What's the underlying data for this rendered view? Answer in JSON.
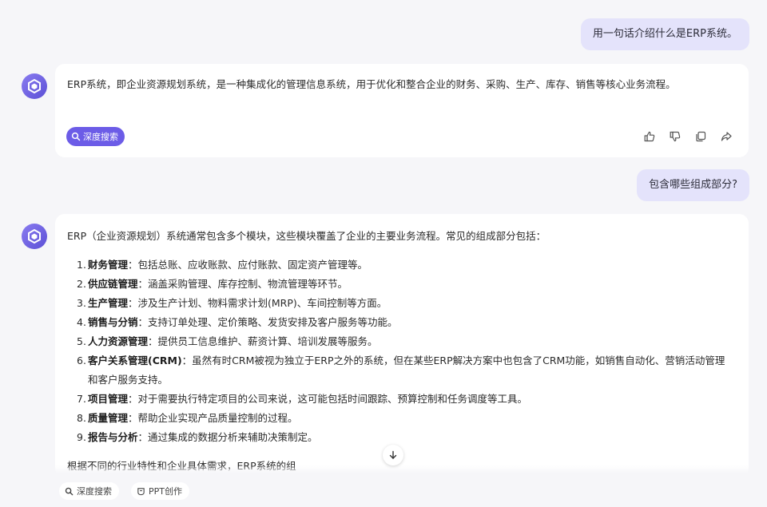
{
  "messages": {
    "q1": "用一句话介绍什么是ERP系统。",
    "a1": "ERP系统，即企业资源规划系统，是一种集成化的管理信息系统，用于优化和整合企业的财务、采购、生产、库存、销售等核心业务流程。",
    "deep_search_label": "深度搜索",
    "q2": "包含哪些组成部分?",
    "a2_intro": "ERP（企业资源规划）系统通常包含多个模块，这些模块覆盖了企业的主要业务流程。常见的组成部分包括：",
    "a2_items": [
      {
        "num": "1.",
        "title": "财务管理",
        "desc": "：包括总账、应收账款、应付账款、固定资产管理等。"
      },
      {
        "num": "2.",
        "title": "供应链管理",
        "desc": "：涵盖采购管理、库存控制、物流管理等环节。"
      },
      {
        "num": "3.",
        "title": "生产管理",
        "desc": "：涉及生产计划、物料需求计划(MRP)、车间控制等方面。"
      },
      {
        "num": "4.",
        "title": "销售与分销",
        "desc": "：支持订单处理、定价策略、发货安排及客户服务等功能。"
      },
      {
        "num": "5.",
        "title": "人力资源管理",
        "desc": "：提供员工信息维护、薪资计算、培训发展等服务。"
      },
      {
        "num": "6.",
        "title": "客户关系管理(CRM)",
        "desc": "：虽然有时CRM被视为独立于ERP之外的系统，但在某些ERP解决方案中也包含了CRM功能，如销售自动化、营销活动管理和客户服务支持。"
      },
      {
        "num": "7.",
        "title": "项目管理",
        "desc": "：对于需要执行特定项目的公司来说，这可能包括时间跟踪、预算控制和任务调度等工具。"
      },
      {
        "num": "8.",
        "title": "质量管理",
        "desc": "：帮助企业实现产品质量控制的过程。"
      },
      {
        "num": "9.",
        "title": "报告与分析",
        "desc": "：通过集成的数据分析来辅助决策制定。"
      }
    ],
    "a2_tail": "根据不同的行业特性和企业具体需求，ERP系统的组"
  },
  "toolbar": {
    "deep_search": "深度搜索",
    "ppt": "PPT创作"
  },
  "colors": {
    "accent": "#6c5ce7",
    "user_bubble": "#e4e3fb",
    "background": "#f6f6f9"
  },
  "icons": {
    "avatar": "assistant-logo-icon",
    "like": "thumbs-up-icon",
    "dislike": "thumbs-down-icon",
    "copy": "copy-icon",
    "share": "share-icon",
    "scroll": "arrow-down-icon"
  }
}
